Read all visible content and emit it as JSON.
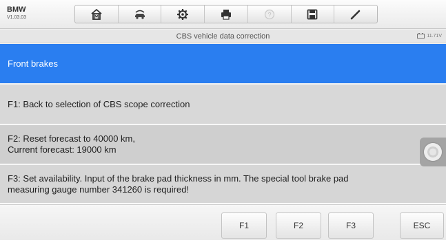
{
  "header": {
    "vehicle_make": "BMW",
    "software_version": "V1.03.03",
    "toolbar_icons": [
      "home-icon",
      "vehicle-swap-icon",
      "gear-icon",
      "printer-icon",
      "help-icon",
      "save-icon",
      "pen-icon"
    ]
  },
  "titlebar": {
    "title": "CBS vehicle data correction",
    "battery_voltage": "11.71V"
  },
  "content": {
    "section_title": "Front brakes",
    "f1_text": "F1: Back to selection of CBS scope correction",
    "f2_line1": "F2: Reset forecast to 40000 km,",
    "f2_line2": "Current forecast: 19000 km",
    "f3_line1": "F3: Set availability. Input of the brake pad thickness in mm. The special tool brake pad",
    "f3_line2": "measuring gauge number 341260 is required!"
  },
  "footer": {
    "buttons": [
      "F1",
      "F2",
      "F3",
      "ESC"
    ]
  },
  "colors": {
    "selected_row": "#2a7ef0",
    "row_background": "#d8d8d8"
  }
}
